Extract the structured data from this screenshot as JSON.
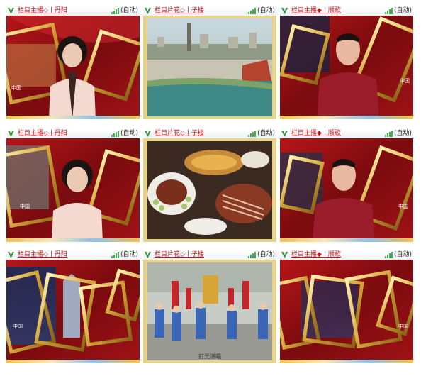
{
  "tiles": [
    {
      "title": "栏目主播◇丨丹阳",
      "status": "(自动)"
    },
    {
      "title": "栏目片花◇丨子楼",
      "status": "(自动)"
    },
    {
      "title": "栏目主播◆丨顺歌",
      "status": "(自动)"
    },
    {
      "title": "栏目主播◇丨丹阳",
      "status": "(自动)"
    },
    {
      "title": "栏目片花◇丨子楼",
      "status": "(自动)"
    },
    {
      "title": "栏目主播◆丨顺歌",
      "status": "(自动)"
    },
    {
      "title": "栏目主播◇丨丹阳",
      "status": "(自动)"
    },
    {
      "title": "栏目片花◇丨子楼",
      "status": "(自动)"
    },
    {
      "title": "栏目主播◆丨顺歌",
      "status": "(自动)"
    }
  ],
  "seal_text": "中国",
  "caption_bottom": "打光演唱",
  "colors": {
    "red_bg": "#8e0f12",
    "gold": "#d8b34a",
    "title_red": "#c0161b",
    "signal_green": "#3fb24a"
  },
  "icons": {
    "logo": "v-logo-icon",
    "signal": "signal-bars-icon"
  }
}
